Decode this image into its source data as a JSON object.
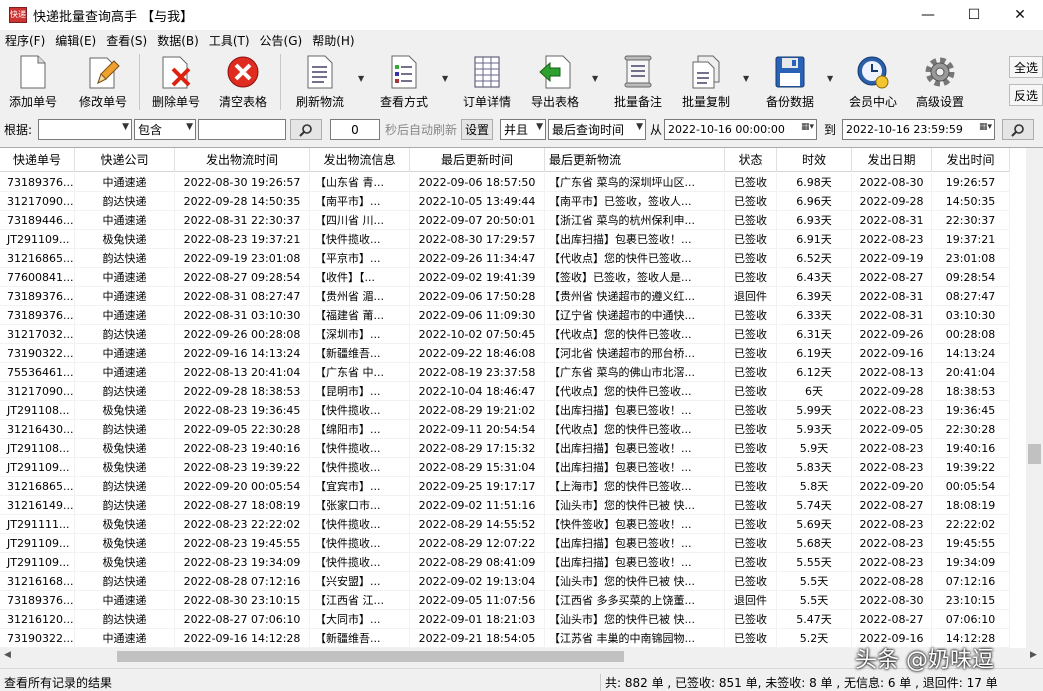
{
  "window": {
    "title": "快递批量查询高手 【与我】",
    "app_icon": "快递",
    "minimize": "—",
    "maximize": "☐",
    "close": "✕"
  },
  "menu": [
    "程序(F)",
    "编辑(E)",
    "查看(S)",
    "数据(B)",
    "工具(T)",
    "公告(G)",
    "帮助(H)"
  ],
  "toolbar": {
    "add": "添加单号",
    "edit": "修改单号",
    "delete": "删除单号",
    "clear": "清空表格",
    "refresh": "刷新物流",
    "view_mode": "查看方式",
    "order_detail": "订单详情",
    "export": "导出表格",
    "batch_note": "批量备注",
    "batch_copy": "批量复制",
    "backup": "备份数据",
    "member": "会员中心",
    "settings": "高级设置",
    "select_all": "全选",
    "invert": "反选"
  },
  "filter": {
    "basis_label": "根据:",
    "basis_value": "",
    "contains_value": "包含",
    "keyword_value": "",
    "interval_value": "0",
    "auto_refresh_text": "秒后自动刷新",
    "settings_btn": "设置",
    "logic_value": "并且",
    "time_field_value": "最后查询时间",
    "from_label": "从",
    "from_value": "2022-10-16 00:00:00",
    "to_label": "到",
    "to_value": "2022-10-16 23:59:59"
  },
  "grid": {
    "headers": [
      "快递单号",
      "快递公司",
      "发出物流时间",
      "发出物流信息",
      "最后更新时间",
      "最后更新物流",
      "状态",
      "时效",
      "发出日期",
      "发出时间"
    ],
    "rows": [
      [
        "73189376...",
        "中通速递",
        "2022-08-30 19:26:57",
        "【山东省 青...",
        "2022-09-06 18:57:50",
        "【广东省 菜鸟的深圳坪山区...",
        "已签收",
        "6.98天",
        "2022-08-30",
        "19:26:57"
      ],
      [
        "31217090...",
        "韵达快递",
        "2022-09-28 14:50:35",
        "【南平市】...",
        "2022-10-05 13:49:44",
        "【南平市】已签收，签收人...",
        "已签收",
        "6.96天",
        "2022-09-28",
        "14:50:35"
      ],
      [
        "73189446...",
        "中通速递",
        "2022-08-31 22:30:37",
        "【四川省 川...",
        "2022-09-07 20:50:01",
        "【浙江省 菜鸟的杭州保利申...",
        "已签收",
        "6.93天",
        "2022-08-31",
        "22:30:37"
      ],
      [
        "JT291109...",
        "极兔快递",
        "2022-08-23 19:37:21",
        "【快件揽收...",
        "2022-08-30 17:29:57",
        "【出库扫描】包裹已签收！...",
        "已签收",
        "6.91天",
        "2022-08-23",
        "19:37:21"
      ],
      [
        "31216865...",
        "韵达快递",
        "2022-09-19 23:01:08",
        "【平京市】...",
        "2022-09-26 11:34:47",
        "【代收点】您的快件已签收...",
        "已签收",
        "6.52天",
        "2022-09-19",
        "23:01:08"
      ],
      [
        "77600841...",
        "中通速递",
        "2022-08-27 09:28:54",
        "【收件】【...",
        "2022-09-02 19:41:39",
        "【签收】已签收，签收人是...",
        "已签收",
        "6.43天",
        "2022-08-27",
        "09:28:54"
      ],
      [
        "73189376...",
        "中通速递",
        "2022-08-31 08:27:47",
        "【贵州省 湄...",
        "2022-09-06 17:50:28",
        "【贵州省 快递超市的遵义红...",
        "退回件",
        "6.39天",
        "2022-08-31",
        "08:27:47"
      ],
      [
        "73189376...",
        "中通速递",
        "2022-08-31 03:10:30",
        "【福建省 莆...",
        "2022-09-06 11:09:30",
        "【辽宁省 快递超市的中通快...",
        "已签收",
        "6.33天",
        "2022-08-31",
        "03:10:30"
      ],
      [
        "31217032...",
        "韵达快递",
        "2022-09-26 00:28:08",
        "【深圳市】...",
        "2022-10-02 07:50:45",
        "【代收点】您的快件已签收...",
        "已签收",
        "6.31天",
        "2022-09-26",
        "00:28:08"
      ],
      [
        "73190322...",
        "中通速递",
        "2022-09-16 14:13:24",
        "【新疆维吾...",
        "2022-09-22 18:46:08",
        "【河北省 快递超市的邢台桥...",
        "已签收",
        "6.19天",
        "2022-09-16",
        "14:13:24"
      ],
      [
        "75536461...",
        "中通速递",
        "2022-08-13 20:41:04",
        "【广东省 中...",
        "2022-08-19 23:37:58",
        "【广东省 菜鸟的佛山市北滘...",
        "已签收",
        "6.12天",
        "2022-08-13",
        "20:41:04"
      ],
      [
        "31217090...",
        "韵达快递",
        "2022-09-28 18:38:53",
        "【昆明市】...",
        "2022-10-04 18:46:47",
        "【代收点】您的快件已签收...",
        "已签收",
        "6天",
        "2022-09-28",
        "18:38:53"
      ],
      [
        "JT291108...",
        "极兔快递",
        "2022-08-23 19:36:45",
        "【快件揽收...",
        "2022-08-29 19:21:02",
        "【出库扫描】包裹已签收！...",
        "已签收",
        "5.99天",
        "2022-08-23",
        "19:36:45"
      ],
      [
        "31216430...",
        "韵达快递",
        "2022-09-05 22:30:28",
        "【绵阳市】...",
        "2022-09-11 20:54:54",
        "【代收点】您的快件已签收...",
        "已签收",
        "5.93天",
        "2022-09-05",
        "22:30:28"
      ],
      [
        "JT291108...",
        "极兔快递",
        "2022-08-23 19:40:16",
        "【快件揽收...",
        "2022-08-29 17:15:32",
        "【出库扫描】包裹已签收！...",
        "已签收",
        "5.9天",
        "2022-08-23",
        "19:40:16"
      ],
      [
        "JT291109...",
        "极兔快递",
        "2022-08-23 19:39:22",
        "【快件揽收...",
        "2022-08-29 15:31:04",
        "【出库扫描】包裹已签收！...",
        "已签收",
        "5.83天",
        "2022-08-23",
        "19:39:22"
      ],
      [
        "31216865...",
        "韵达快递",
        "2022-09-20 00:05:54",
        "【宜宾市】...",
        "2022-09-25 19:17:17",
        "【上海市】您的快件已签收...",
        "已签收",
        "5.8天",
        "2022-09-20",
        "00:05:54"
      ],
      [
        "31216149...",
        "韵达快递",
        "2022-08-27 18:08:19",
        "【张家口市...",
        "2022-09-02 11:51:16",
        "【汕头市】您的快件已被 快...",
        "已签收",
        "5.74天",
        "2022-08-27",
        "18:08:19"
      ],
      [
        "JT291111...",
        "极兔快递",
        "2022-08-23 22:22:02",
        "【快件揽收...",
        "2022-08-29 14:55:52",
        "【快件签收】包裹已签收！...",
        "已签收",
        "5.69天",
        "2022-08-23",
        "22:22:02"
      ],
      [
        "JT291109...",
        "极兔快递",
        "2022-08-23 19:45:55",
        "【快件揽收...",
        "2022-08-29 12:07:22",
        "【出库扫描】包裹已签收！...",
        "已签收",
        "5.68天",
        "2022-08-23",
        "19:45:55"
      ],
      [
        "JT291109...",
        "极兔快递",
        "2022-08-23 19:34:09",
        "【快件揽收...",
        "2022-08-29 08:41:09",
        "【出库扫描】包裹已签收！...",
        "已签收",
        "5.55天",
        "2022-08-23",
        "19:34:09"
      ],
      [
        "31216168...",
        "韵达快递",
        "2022-08-28 07:12:16",
        "【兴安盟】...",
        "2022-09-02 19:13:04",
        "【汕头市】您的快件已被 快...",
        "已签收",
        "5.5天",
        "2022-08-28",
        "07:12:16"
      ],
      [
        "73189376...",
        "中通速递",
        "2022-08-30 23:10:15",
        "【江西省 江...",
        "2022-09-05 11:07:56",
        "【江西省 多多买菜的上饶董...",
        "退回件",
        "5.5天",
        "2022-08-30",
        "23:10:15"
      ],
      [
        "31216120...",
        "韵达快递",
        "2022-08-27 07:06:10",
        "【大同市】...",
        "2022-09-01 18:21:03",
        "【汕头市】您的快件已被 快...",
        "已签收",
        "5.47天",
        "2022-08-27",
        "07:06:10"
      ],
      [
        "73190322...",
        "中通速递",
        "2022-09-16 14:12:28",
        "【新疆维吾...",
        "2022-09-21 18:54:05",
        "【江苏省 丰巢的中南锦园物...",
        "已签收",
        "5.2天",
        "2022-09-16",
        "14:12:28"
      ]
    ]
  },
  "status": {
    "left": "查看所有记录的结果",
    "right": "共: 882 单 , 已签收: 851 单, 未签收: 8 单 , 无信息: 6 单 , 退回件: 17 单"
  },
  "watermark": "头条 @奶味逗"
}
